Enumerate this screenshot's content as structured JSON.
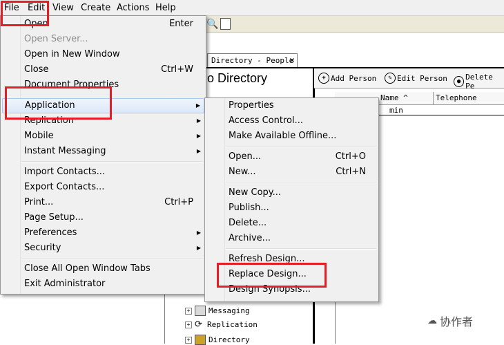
{
  "menubar": [
    "File",
    "Edit",
    "View",
    "Create",
    "Actions",
    "Help"
  ],
  "document_tab": {
    "label": "Directory - People",
    "close": "✕"
  },
  "directory_title": "o Directory",
  "actions": [
    "Add Person",
    "Edit Person",
    "Delete Pe"
  ],
  "columns": {
    "name": "Name ^",
    "telephone": "Telephone"
  },
  "first_row": "min",
  "tree_items": [
    "Messaging",
    "Replication",
    "Directory"
  ],
  "file_menu": [
    {
      "label": "Open",
      "shortcut": "Enter"
    },
    {
      "label": "Open Server...",
      "disabled": true
    },
    {
      "label": "Open in New Window"
    },
    {
      "label": "Close",
      "shortcut": "Ctrl+W"
    },
    {
      "label": "Document Properties"
    },
    {
      "label": "Application",
      "submenu": true,
      "highlighted": true
    },
    {
      "label": "Replication",
      "submenu": true
    },
    {
      "label": "Mobile",
      "submenu": true
    },
    {
      "label": "Instant Messaging",
      "submenu": true
    },
    {
      "label": "Import Contacts..."
    },
    {
      "label": "Export Contacts..."
    },
    {
      "label": "Print...",
      "shortcut": "Ctrl+P"
    },
    {
      "label": "Page Setup..."
    },
    {
      "label": "Preferences",
      "submenu": true
    },
    {
      "label": "Security",
      "submenu": true
    },
    {
      "label": "Close All Open Window Tabs"
    },
    {
      "label": "Exit Administrator"
    }
  ],
  "application_menu": [
    {
      "label": "Properties"
    },
    {
      "label": "Access Control..."
    },
    {
      "label": "Make Available Offline..."
    },
    {
      "label": "Open...",
      "shortcut": "Ctrl+O"
    },
    {
      "label": "New...",
      "shortcut": "Ctrl+N"
    },
    {
      "label": "New Copy..."
    },
    {
      "label": "Publish..."
    },
    {
      "label": "Delete..."
    },
    {
      "label": "Archive..."
    },
    {
      "label": "Refresh Design..."
    },
    {
      "label": "Replace Design..."
    },
    {
      "label": "Design Synopsis..."
    }
  ],
  "watermark": "协作者",
  "colors": {
    "callout": "#e31e24",
    "highlight": "#dce8f8"
  }
}
